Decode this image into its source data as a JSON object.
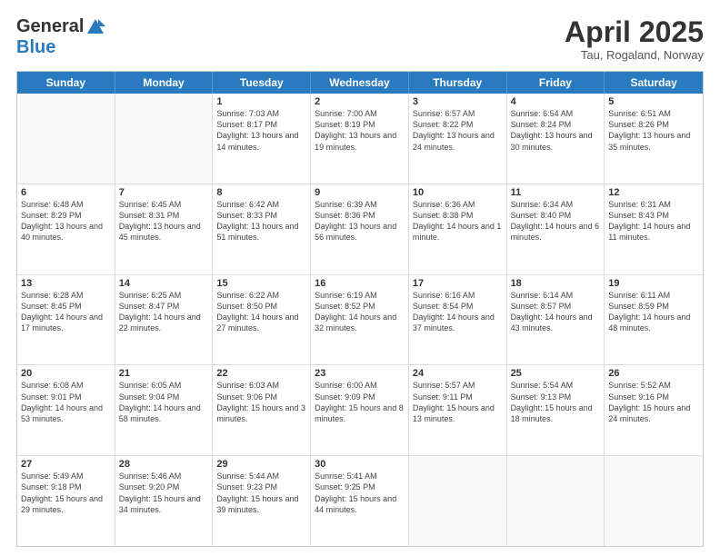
{
  "header": {
    "logo_general": "General",
    "logo_blue": "Blue",
    "month_title": "April 2025",
    "subtitle": "Tau, Rogaland, Norway"
  },
  "weekdays": [
    "Sunday",
    "Monday",
    "Tuesday",
    "Wednesday",
    "Thursday",
    "Friday",
    "Saturday"
  ],
  "rows": [
    [
      {
        "day": "",
        "info": ""
      },
      {
        "day": "",
        "info": ""
      },
      {
        "day": "1",
        "info": "Sunrise: 7:03 AM\nSunset: 8:17 PM\nDaylight: 13 hours and 14 minutes."
      },
      {
        "day": "2",
        "info": "Sunrise: 7:00 AM\nSunset: 8:19 PM\nDaylight: 13 hours and 19 minutes."
      },
      {
        "day": "3",
        "info": "Sunrise: 6:57 AM\nSunset: 8:22 PM\nDaylight: 13 hours and 24 minutes."
      },
      {
        "day": "4",
        "info": "Sunrise: 6:54 AM\nSunset: 8:24 PM\nDaylight: 13 hours and 30 minutes."
      },
      {
        "day": "5",
        "info": "Sunrise: 6:51 AM\nSunset: 8:26 PM\nDaylight: 13 hours and 35 minutes."
      }
    ],
    [
      {
        "day": "6",
        "info": "Sunrise: 6:48 AM\nSunset: 8:29 PM\nDaylight: 13 hours and 40 minutes."
      },
      {
        "day": "7",
        "info": "Sunrise: 6:45 AM\nSunset: 8:31 PM\nDaylight: 13 hours and 45 minutes."
      },
      {
        "day": "8",
        "info": "Sunrise: 6:42 AM\nSunset: 8:33 PM\nDaylight: 13 hours and 51 minutes."
      },
      {
        "day": "9",
        "info": "Sunrise: 6:39 AM\nSunset: 8:36 PM\nDaylight: 13 hours and 56 minutes."
      },
      {
        "day": "10",
        "info": "Sunrise: 6:36 AM\nSunset: 8:38 PM\nDaylight: 14 hours and 1 minute."
      },
      {
        "day": "11",
        "info": "Sunrise: 6:34 AM\nSunset: 8:40 PM\nDaylight: 14 hours and 6 minutes."
      },
      {
        "day": "12",
        "info": "Sunrise: 6:31 AM\nSunset: 8:43 PM\nDaylight: 14 hours and 11 minutes."
      }
    ],
    [
      {
        "day": "13",
        "info": "Sunrise: 6:28 AM\nSunset: 8:45 PM\nDaylight: 14 hours and 17 minutes."
      },
      {
        "day": "14",
        "info": "Sunrise: 6:25 AM\nSunset: 8:47 PM\nDaylight: 14 hours and 22 minutes."
      },
      {
        "day": "15",
        "info": "Sunrise: 6:22 AM\nSunset: 8:50 PM\nDaylight: 14 hours and 27 minutes."
      },
      {
        "day": "16",
        "info": "Sunrise: 6:19 AM\nSunset: 8:52 PM\nDaylight: 14 hours and 32 minutes."
      },
      {
        "day": "17",
        "info": "Sunrise: 6:16 AM\nSunset: 8:54 PM\nDaylight: 14 hours and 37 minutes."
      },
      {
        "day": "18",
        "info": "Sunrise: 6:14 AM\nSunset: 8:57 PM\nDaylight: 14 hours and 43 minutes."
      },
      {
        "day": "19",
        "info": "Sunrise: 6:11 AM\nSunset: 8:59 PM\nDaylight: 14 hours and 48 minutes."
      }
    ],
    [
      {
        "day": "20",
        "info": "Sunrise: 6:08 AM\nSunset: 9:01 PM\nDaylight: 14 hours and 53 minutes."
      },
      {
        "day": "21",
        "info": "Sunrise: 6:05 AM\nSunset: 9:04 PM\nDaylight: 14 hours and 58 minutes."
      },
      {
        "day": "22",
        "info": "Sunrise: 6:03 AM\nSunset: 9:06 PM\nDaylight: 15 hours and 3 minutes."
      },
      {
        "day": "23",
        "info": "Sunrise: 6:00 AM\nSunset: 9:09 PM\nDaylight: 15 hours and 8 minutes."
      },
      {
        "day": "24",
        "info": "Sunrise: 5:57 AM\nSunset: 9:11 PM\nDaylight: 15 hours and 13 minutes."
      },
      {
        "day": "25",
        "info": "Sunrise: 5:54 AM\nSunset: 9:13 PM\nDaylight: 15 hours and 18 minutes."
      },
      {
        "day": "26",
        "info": "Sunrise: 5:52 AM\nSunset: 9:16 PM\nDaylight: 15 hours and 24 minutes."
      }
    ],
    [
      {
        "day": "27",
        "info": "Sunrise: 5:49 AM\nSunset: 9:18 PM\nDaylight: 15 hours and 29 minutes."
      },
      {
        "day": "28",
        "info": "Sunrise: 5:46 AM\nSunset: 9:20 PM\nDaylight: 15 hours and 34 minutes."
      },
      {
        "day": "29",
        "info": "Sunrise: 5:44 AM\nSunset: 9:23 PM\nDaylight: 15 hours and 39 minutes."
      },
      {
        "day": "30",
        "info": "Sunrise: 5:41 AM\nSunset: 9:25 PM\nDaylight: 15 hours and 44 minutes."
      },
      {
        "day": "",
        "info": ""
      },
      {
        "day": "",
        "info": ""
      },
      {
        "day": "",
        "info": ""
      }
    ]
  ]
}
